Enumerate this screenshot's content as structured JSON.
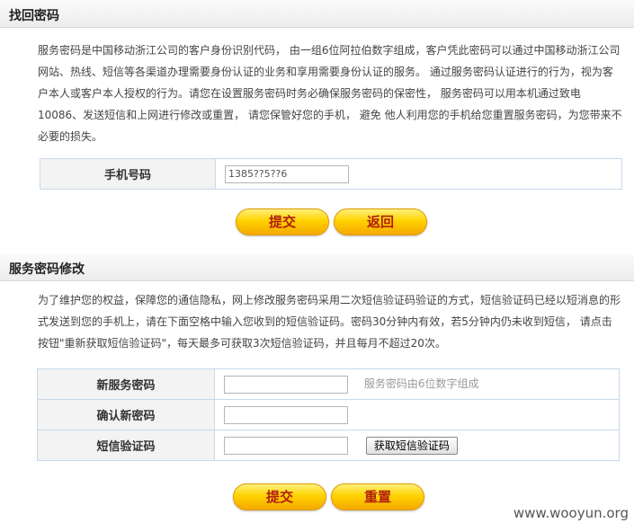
{
  "find_password": {
    "title": "找回密码",
    "description": "服务密码是中国移动浙江公司的客户身份识别代码， 由一组6位阿拉伯数字组成，客户凭此密码可以通过中国移动浙江公司网站、热线、短信等各渠道办理需要身份认证的业务和享用需要身份认证的服务。 通过服务密码认证进行的行为，视为客户本人或客户本人授权的行为。请您在设置服务密码时务必确保服务密码的保密性， 服务密码可以用本机通过致电10086、发送短信和上网进行修改或重置， 请您保管好您的手机， 避免 他人利用您的手机给您重置服务密码，为您带来不必要的损失。",
    "phone_label": "手机号码",
    "phone_value": "1385??5??6",
    "submit_label": "提交",
    "back_label": "返回"
  },
  "modify_password": {
    "title": "服务密码修改",
    "description": "为了维护您的权益，保障您的通信隐私，网上修改服务密码采用二次短信验证码验证的方式，短信验证码已经以短消息的形式发送到您的手机上，请在下面空格中输入您收到的短信验证码。密码30分钟内有效，若5分钟内仍未收到短信， 请点击按钮\"重新获取短信验证码\"，每天最多可获取3次短信验证码，并且每月不超过20次。",
    "new_password_label": "新服务密码",
    "new_password_hint": "服务密码由6位数字组成",
    "confirm_password_label": "确认新密码",
    "sms_code_label": "短信验证码",
    "get_code_label": "获取短信验证码",
    "submit_label": "提交",
    "reset_label": "重置"
  },
  "watermark": "www.wooyun.org"
}
